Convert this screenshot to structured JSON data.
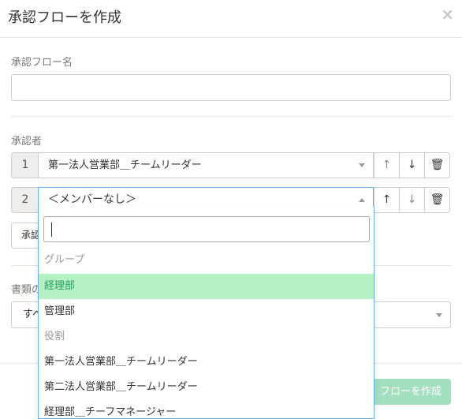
{
  "modal": {
    "title": "承認フローを作成",
    "close": "×"
  },
  "form": {
    "flow_name_label": "承認フロー名",
    "flow_name_value": "",
    "approvers_label": "承認者",
    "approvers": [
      {
        "num": "1",
        "value": "第一法人営業部＿チームリーダー"
      },
      {
        "num": "2",
        "value": "＜メンバーなし＞"
      }
    ],
    "add_button_label": "承認",
    "doc_type_label": "書類の",
    "doc_type_value": "すべ"
  },
  "icons": {
    "up": "↑",
    "down": "↓",
    "trash": "🗑"
  },
  "dropdown": {
    "search_value": "",
    "groups": [
      {
        "label": "グループ",
        "items": [
          "経理部",
          "管理部"
        ]
      },
      {
        "label": "役割",
        "items": [
          "第一法人営業部＿チームリーダー",
          "第二法人営業部＿チームリーダー",
          "経理部＿チーフマネージャー"
        ]
      }
    ],
    "selected": "経理部"
  },
  "footer": {
    "create_button": "フローを作成"
  },
  "colors": {
    "highlight_bg": "#b6f0c5",
    "highlight_text": "#2aa15b",
    "create_button_bg": "#a3e0c0",
    "focus_border": "#66afe9"
  }
}
